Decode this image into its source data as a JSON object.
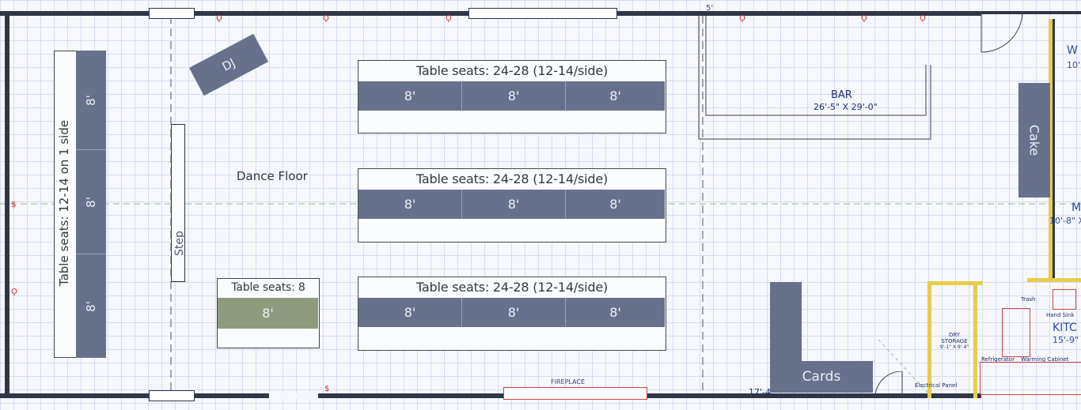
{
  "long_table": {
    "title": "Table seats: 12-14 on 1 side",
    "segments": [
      "8'",
      "8'",
      "8'"
    ]
  },
  "dj_label": "DJ",
  "step_label": "Step",
  "dance_floor_label": "Dance Floor",
  "tables": [
    {
      "title": "Table seats: 24-28 (12-14/side)",
      "segments": [
        "8'",
        "8'",
        "8'"
      ]
    },
    {
      "title": "Table seats: 24-28 (12-14/side)",
      "segments": [
        "8'",
        "8'",
        "8'"
      ]
    },
    {
      "title": "Table seats: 24-28 (12-14/side)",
      "segments": [
        "8'",
        "8'",
        "8'"
      ]
    }
  ],
  "small_table": {
    "title": "Table seats: 8",
    "segment": "8'",
    "color": "#8f9b7f"
  },
  "bar": {
    "label": "BAR",
    "dimensions": "26'-5\" X 29'-0\""
  },
  "cake_label": "Cake",
  "cards_label": "Cards",
  "fireplace_label": "FIREPLACE",
  "bottom_dimension": "17'-4\"",
  "top_dimension": "5'",
  "room_labels": {
    "w": "W",
    "w_dim": "10'",
    "me": "ME",
    "me_dim": "10'-8\" X",
    "kitchen": "KITC",
    "kitchen_dim": "15'-9\"",
    "dry_storage": "DRY STORAGE",
    "dry_storage_dim": "9'-1\" X 9'-4\"",
    "trash": "Trash",
    "hand_sink": "Hand Sink",
    "refrigerator": "Refrigerator",
    "warming_cabinet": "Warming Cabinet",
    "electrical_panel": "Electrical Panel"
  },
  "colors": {
    "table_slate": "#67718c",
    "wall": "#2f3648",
    "accent_yellow": "#e7cd4f"
  }
}
